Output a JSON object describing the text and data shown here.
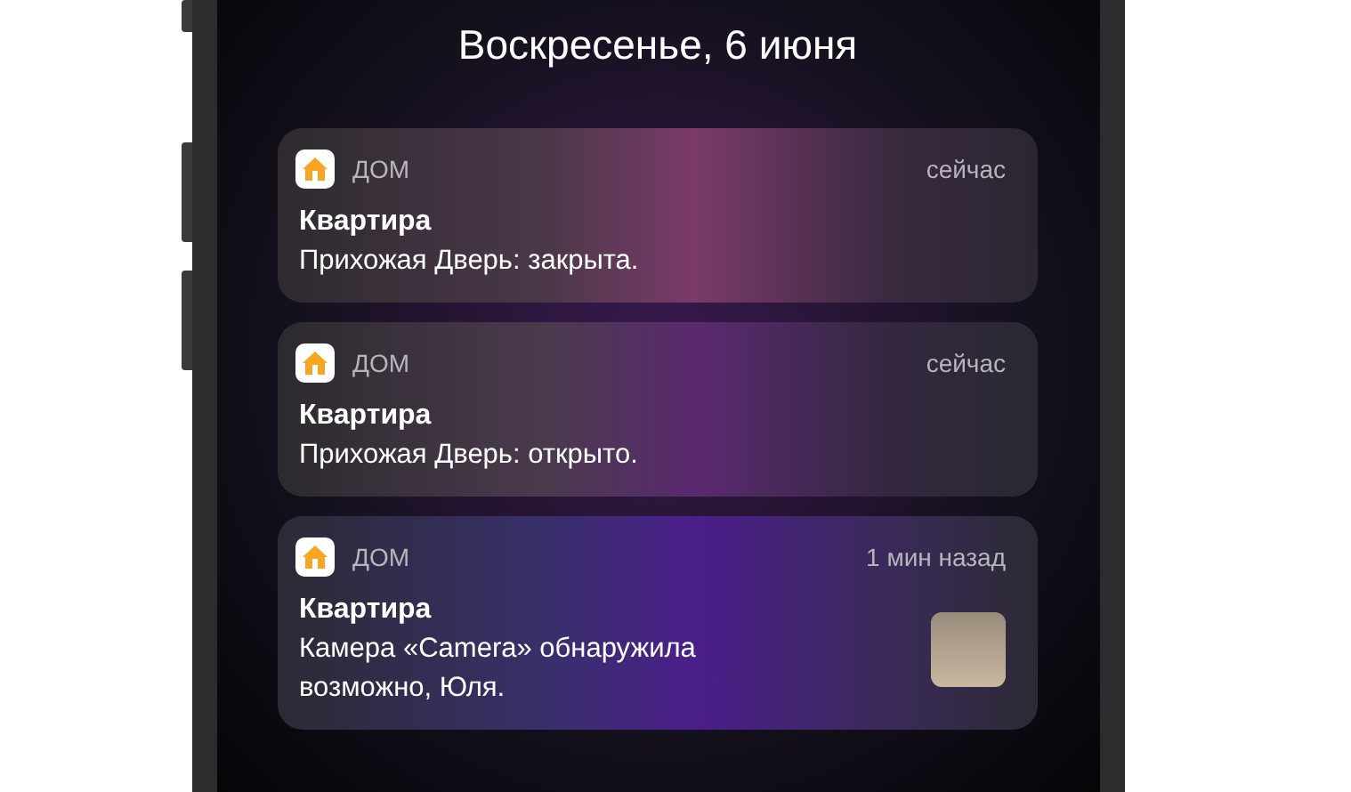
{
  "date": "Воскресенье, 6 июня",
  "notifications": [
    {
      "kind": "plain",
      "app": "ДОМ",
      "time": "сейчас",
      "title": "Квартира",
      "body": "Прихожая Дверь: закрыта."
    },
    {
      "kind": "plain",
      "app": "ДОМ",
      "time": "сейчас",
      "title": "Квартира",
      "body": "Прихожая Дверь: открыто."
    },
    {
      "kind": "image",
      "app": "ДОМ",
      "time": "1 мин назад",
      "title": "Квартира",
      "body": "Камера «Camera» обнаружила возможно, Юля."
    }
  ]
}
